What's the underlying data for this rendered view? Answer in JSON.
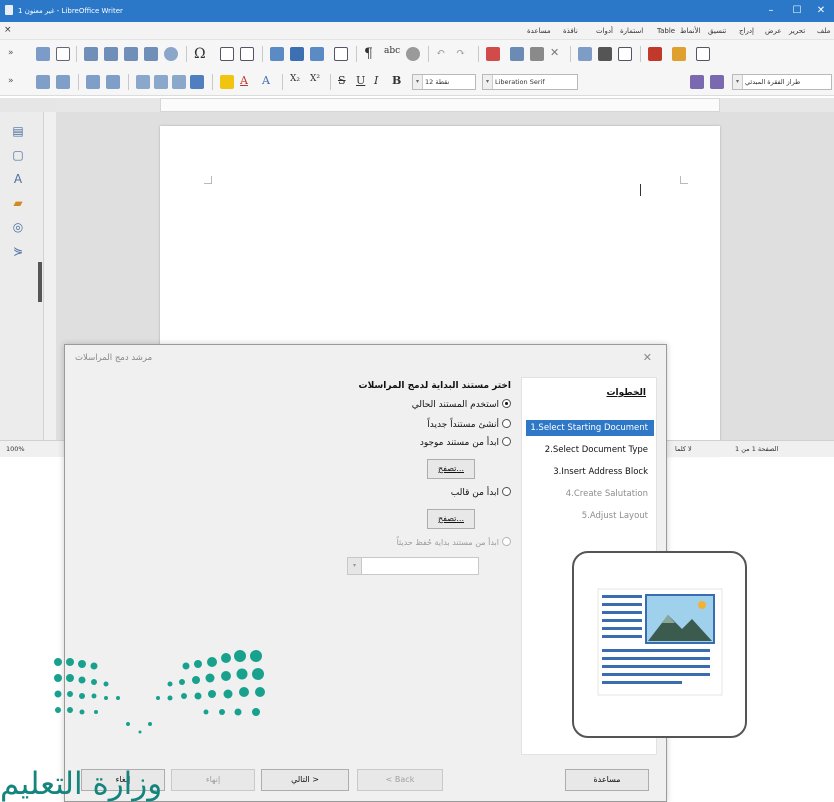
{
  "window": {
    "title": "غير معنون 1 - LibreOffice Writer",
    "controls": [
      "–",
      "☐",
      "✕"
    ]
  },
  "menubar": {
    "items": [
      "ملف",
      "تحرير",
      "عرض",
      "إدراج",
      "تنسيق",
      "الأنماط",
      "Table",
      "استمارة",
      "أدوات",
      "نافذة",
      "مساعدة"
    ]
  },
  "toolbar": {
    "paragraph_style": "طراز الفقرة المبدئي",
    "font_name": "Liberation Serif",
    "font_size": "12 نقطة"
  },
  "statusbar": {
    "page": "الصفحة 1 من 1",
    "words": "لا كلما",
    "zoom": "100%"
  },
  "dialog": {
    "title": "مرشد دمج المراسلات",
    "steps_heading": "الخطوات",
    "steps": [
      {
        "label": "1.Select Starting Document",
        "state": "active"
      },
      {
        "label": "2.Select Document Type",
        "state": "enabled"
      },
      {
        "label": "3.Insert Address Block",
        "state": "enabled"
      },
      {
        "label": "4.Create Salutation",
        "state": "disabled"
      },
      {
        "label": "5.Adjust Layout",
        "state": "disabled"
      }
    ],
    "heading": "اختر مستند البداية لدمج المراسلات",
    "options": [
      {
        "label": "استخدم المستند الحالي",
        "checked": true,
        "disabled": false
      },
      {
        "label": "أنشئ مستنداً جديداً",
        "checked": false,
        "disabled": false
      },
      {
        "label": "ابدأ من مستند موجود",
        "checked": false,
        "disabled": false
      },
      {
        "label": "ابدأ من قالب",
        "checked": false,
        "disabled": false
      },
      {
        "label": "ابدأ من مستند بداية حُفظ حديثاً",
        "checked": false,
        "disabled": true
      }
    ],
    "browse_label": "تصفح...",
    "buttons": {
      "help": "مساعدة",
      "back": "< Back",
      "next": "التالي >",
      "finish": "إنهاء",
      "cancel": "إلغاء"
    }
  },
  "overlay": {
    "logo_text": "وزارة التعليم"
  },
  "colors": {
    "titlebar": "#2b78c9",
    "active_step": "#2f78c7",
    "logo": "#14857d"
  }
}
